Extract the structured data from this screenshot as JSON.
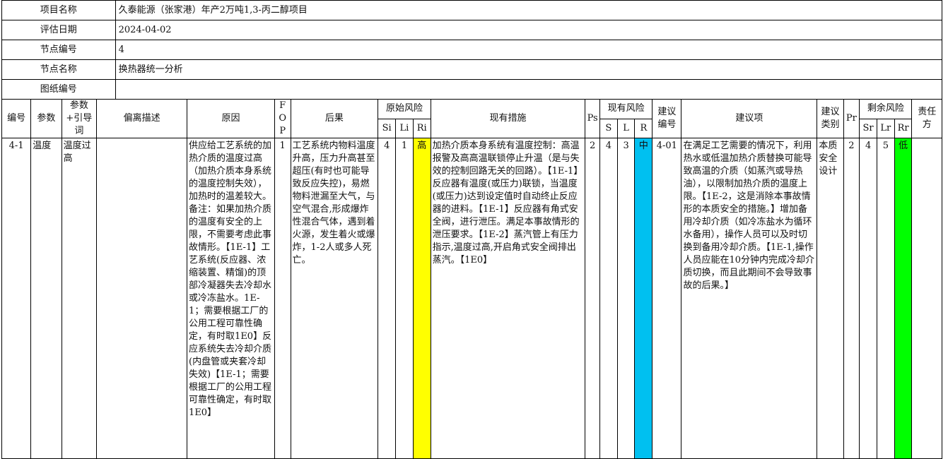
{
  "meta": {
    "project_label": "项目名称",
    "project_value": "久泰能源（张家港）年产2万吨1,3-丙二醇项目",
    "date_label": "评估日期",
    "date_value": "2024-04-02",
    "node_no_label": "节点编号",
    "node_no_value": "4",
    "node_name_label": "节点名称",
    "node_name_value": "换热器统一分析",
    "drawing_label": "图纸编号",
    "drawing_value": ""
  },
  "headers": {
    "no": "编号",
    "param": "参数",
    "guideword": "参数+引导词",
    "deviation": "偏离描述",
    "cause": "原因",
    "fop": "FOP",
    "consequence": "后果",
    "orig_risk": "原始风险",
    "si": "Si",
    "li": "Li",
    "ri": "Ri",
    "measures": "现有措施",
    "ps": "Ps",
    "cur_risk": "现有风险",
    "s": "S",
    "l": "L",
    "r": "R",
    "rec_no": "建议编号",
    "rec": "建议项",
    "rec_type": "建议类别",
    "pr": "Pr",
    "res_risk": "剩余风险",
    "sr": "Sr",
    "lr": "Lr",
    "rr": "Rr",
    "owner": "责任方"
  },
  "row": {
    "no": "4-1",
    "param": "温度",
    "guideword": "温度过高",
    "deviation": "",
    "cause": "供应给工艺系统的加热介质的温度过高（加热介质本身系统的温度控制失效），加热时的温差较大。备注：如果加热介质的温度有安全的上限，不需要考虑此事故情形。【1E-1】工艺系统(反应器、浓缩装置、精馏)的顶部冷凝器失去冷却水或冷冻盐水。1E-1；需要根据工厂的公用工程可靠性确定，有时取1E0】反应系统失去冷却介质(内盘管或夹套冷却失效)【1E-1；需要根据工厂的公用工程可靠性确定，有时取1E0】",
    "fop": "1",
    "consequence": "工艺系统内物料温度升高，压力升高甚至超压(有时也可能导致反应失控)，易燃物料泄漏至大气，与空气混合,形成爆炸性混合气体，遇到着火源，发生着火或爆炸，1-2人或多人死亡。",
    "si": "4",
    "li": "1",
    "ri": "高",
    "measures": "加热介质本身系统有温度控制：高温报警及高高温联锁停止升温（是与失效的控制回路无关的回路）。【1E-1】反应器有温度(或压力)联锁，当温度(或压力)达到设定值时自动终止反应器的进料。【1E-1】反应器有角式安全阀，进行泄压。满足本事故情形的泄压要求。【1E-2】蒸汽管上有压力指示,温度过高,开启角式安全阀排出蒸汽。【1E0】",
    "ps": "2",
    "s": "4",
    "l": "3",
    "r": "中",
    "rec_no": "4-01",
    "rec": "在满足工艺需要的情况下，利用热水或低温加热介质替换可能导致高温的介质（如蒸汽或导热油），以限制加热介质的温度上限。【1E-2，这是消除本事故情形的本质安全的措施。】增加备用冷却介质（如冷冻盐水为循环水备用），操作人员可以及时切换到备用冷却介质。【1E-1,操作人员应能在10分钟内完成冷却介质切换，而且此期间不会导致事故的后果。】",
    "rec_type": "本质安全设计",
    "pr": "2",
    "sr": "4",
    "lr": "5",
    "rr": "低",
    "owner": ""
  },
  "colors": {
    "ri_high": "#ffff00",
    "r_mid": "#00c0f0",
    "rr_low": "#00ff00"
  }
}
